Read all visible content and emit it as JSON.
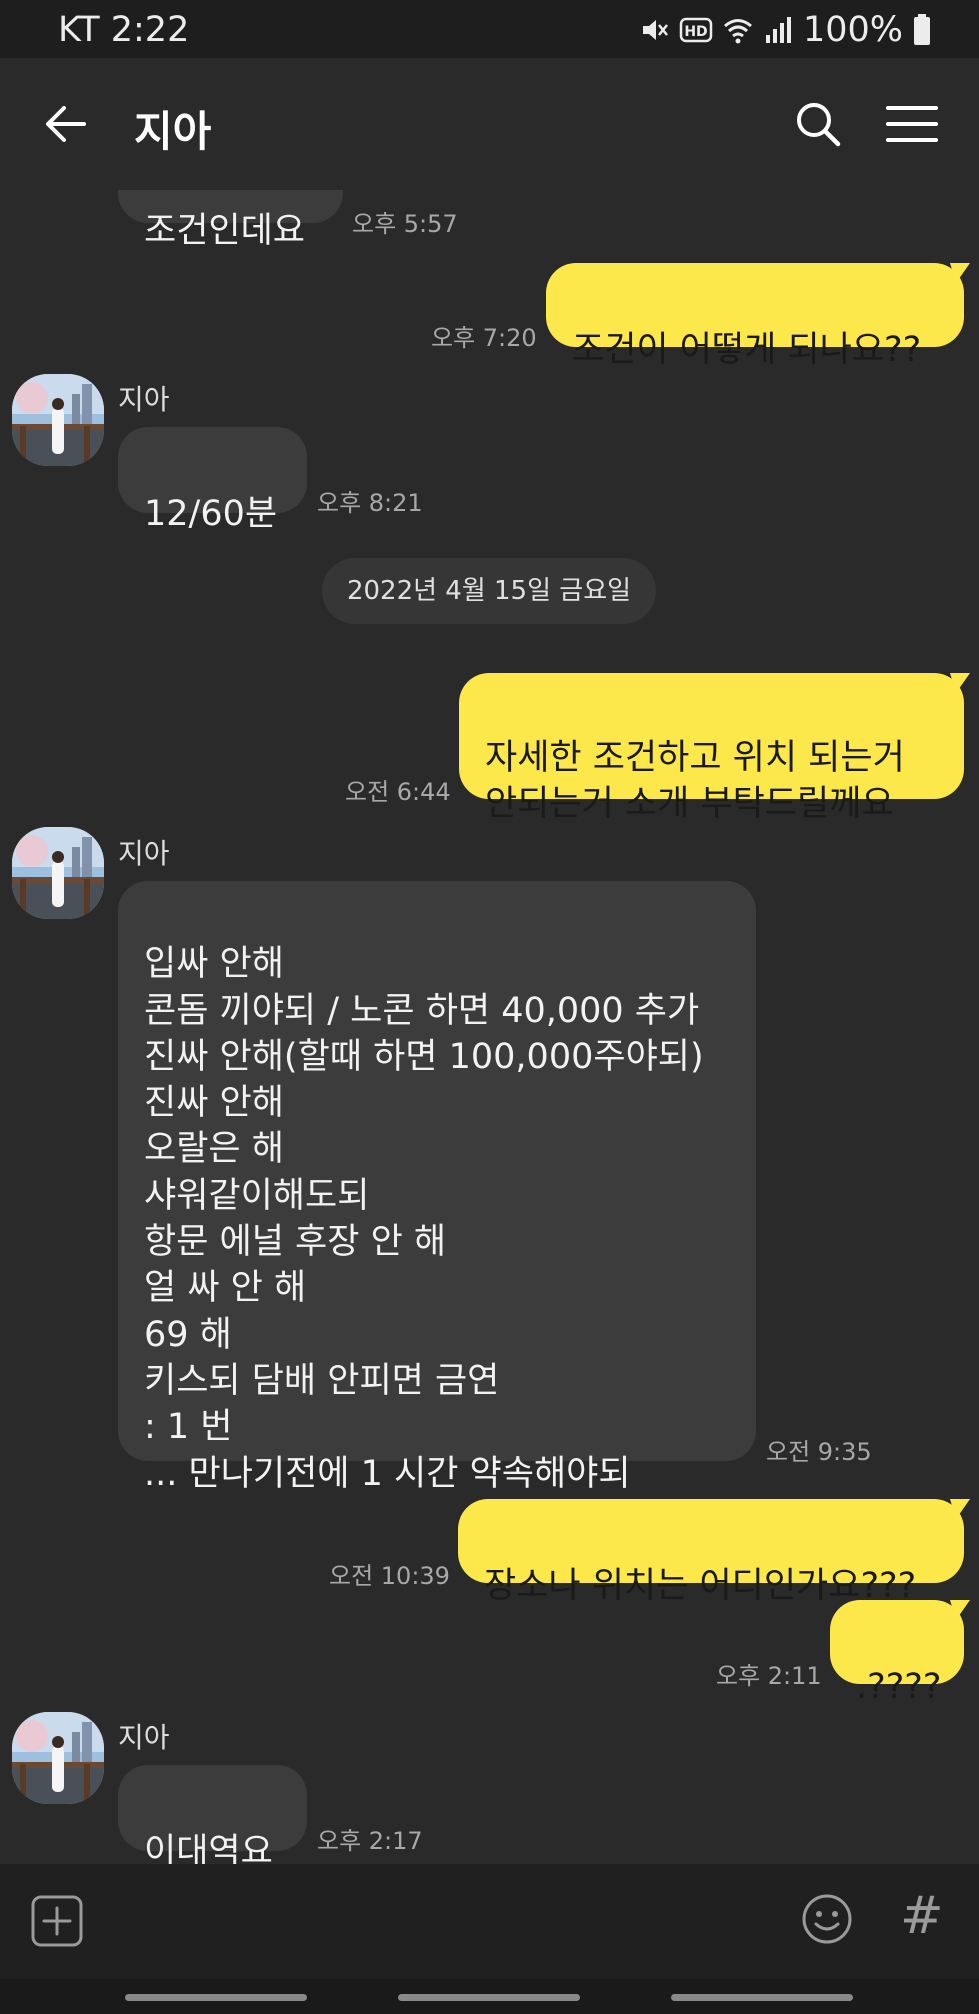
{
  "status_bar": {
    "carrier_time": "KT 2:22",
    "battery": "100%",
    "hd_label": "HD",
    "icons": [
      "mute-icon",
      "hd-icon",
      "wifi-icon",
      "signal-icon",
      "battery-icon"
    ]
  },
  "header": {
    "title": "지아",
    "icons": [
      "back-arrow-icon",
      "search-icon",
      "menu-icon"
    ]
  },
  "messages": [
    {
      "side": "in",
      "text": "조건인데요",
      "time": "오후 5:57"
    },
    {
      "side": "out",
      "text": "조건이 어떻게 되나요??",
      "time": "오후 7:20"
    },
    {
      "side": "in",
      "sender": "지아",
      "text": "12/60분",
      "time": "오후 8:21"
    },
    {
      "side": "out",
      "text": "자세한 조건하고 위치 되는거\n안되는거 소개 부탁드릴께요",
      "time": "오전 6:44"
    },
    {
      "side": "in",
      "sender": "지아",
      "text": "입싸 안해\n콘돔 끼야되 / 노콘 하면 40,000 추가\n진싸 안해(할때 하면 100,000주야되)\n진싸 안해\n오랄은 해\n샤워같이해도되\n항문 에널 후장 안 해\n얼 싸 안 해\n69 해\n키스되 담배 안피면 금연\n: 1 번\n...  만나기전에 1 시간 약속해야되",
      "time": "오전 9:35"
    },
    {
      "side": "out",
      "text": "장소나 위치는 어디인가요???",
      "time": "오전 10:39"
    },
    {
      "side": "out",
      "text": ".????",
      "time": "오후 2:11"
    },
    {
      "side": "in",
      "sender": "지아",
      "text": "이대역요",
      "time": "오후 2:17"
    }
  ],
  "date_divider": "2022년 4월 15일 금요일",
  "input_bar": {
    "icons": [
      "add-icon",
      "emoji-icon",
      "hashtag-icon"
    ],
    "hash_glyph": "#"
  },
  "colors": {
    "background": "#2a2a2a",
    "incoming_bubble": "#3c3c3c",
    "outgoing_bubble": "#fde84b"
  }
}
